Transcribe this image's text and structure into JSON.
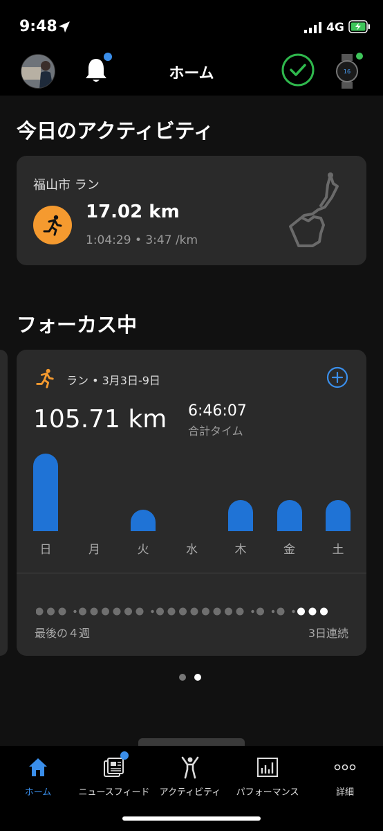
{
  "status_bar": {
    "time": "9:48",
    "network": "4G"
  },
  "header": {
    "title": "ホーム"
  },
  "today": {
    "section_title": "今日のアクティビティ",
    "activity": {
      "name": "福山市 ラン",
      "distance": "17.02 km",
      "meta": "1:04:29 • 3:47 /km"
    }
  },
  "focus": {
    "section_title": "フォーカス中",
    "label": "ラン • 3月3日-9日",
    "total_distance": "105.71 km",
    "total_time": "6:46:07",
    "total_time_label": "合計タイム",
    "streak_left": "最後の４週",
    "streak_right": "3日連続"
  },
  "chart_data": {
    "type": "bar",
    "categories": [
      "日",
      "月",
      "火",
      "水",
      "木",
      "金",
      "土"
    ],
    "values": [
      1.0,
      0,
      0.28,
      0,
      0.4,
      0.4,
      0.4
    ],
    "ylim": [
      0,
      1
    ]
  },
  "streak_pattern": [
    1,
    1,
    1,
    0,
    1,
    1,
    1,
    1,
    1,
    1,
    0,
    1,
    1,
    1,
    1,
    1,
    1,
    1,
    1,
    0,
    1,
    0,
    1,
    0,
    2,
    2,
    2
  ],
  "pager": {
    "count": 2,
    "active": 1
  },
  "tabs": [
    {
      "label": "ホーム",
      "icon": "home-icon",
      "active": true
    },
    {
      "label": "ニュースフィード",
      "icon": "newsfeed-icon",
      "active": false
    },
    {
      "label": "アクティビティ",
      "icon": "activity-person-icon",
      "active": false
    },
    {
      "label": "パフォーマンス",
      "icon": "performance-chart-icon",
      "active": false
    },
    {
      "label": "詳細",
      "icon": "more-dots-icon",
      "active": false
    }
  ],
  "colors": {
    "accent": "#3a8eea",
    "bar": "#1f73d6",
    "run_orange": "#f59a2f",
    "check_green": "#2fb84d"
  }
}
